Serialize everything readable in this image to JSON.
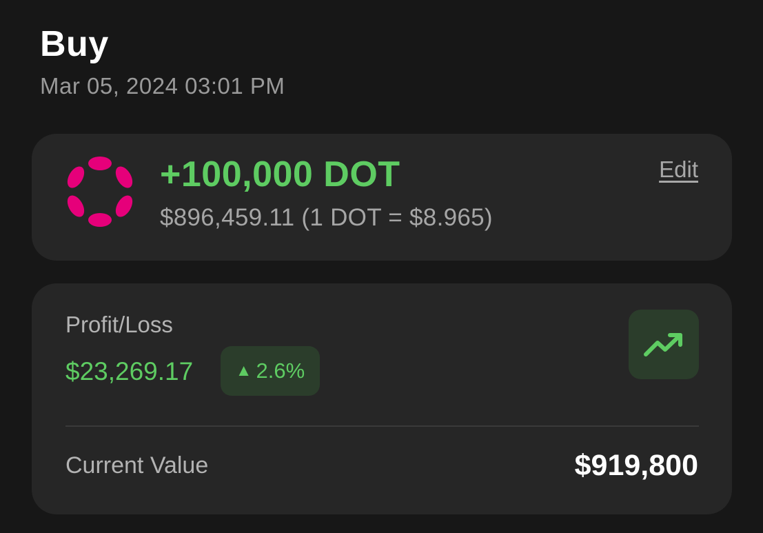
{
  "header": {
    "title": "Buy",
    "datetime": "Mar 05, 2024 03:01 PM"
  },
  "transaction": {
    "asset_icon": "polkadot-logo",
    "amount": "+100,000 DOT",
    "fiat_detail": "$896,459.11 (1 DOT = $8.965)",
    "edit_label": "Edit"
  },
  "profit_loss": {
    "label": "Profit/Loss",
    "value": "$23,269.17",
    "percent": "2.6%",
    "trend_icon": "trending-up-icon"
  },
  "current_value": {
    "label": "Current Value",
    "value": "$919,800"
  },
  "colors": {
    "background": "#171717",
    "card": "#262626",
    "positive": "#5ecc62",
    "badge_bg": "#2b3d2b",
    "polkadot_pink": "#e6007a"
  }
}
